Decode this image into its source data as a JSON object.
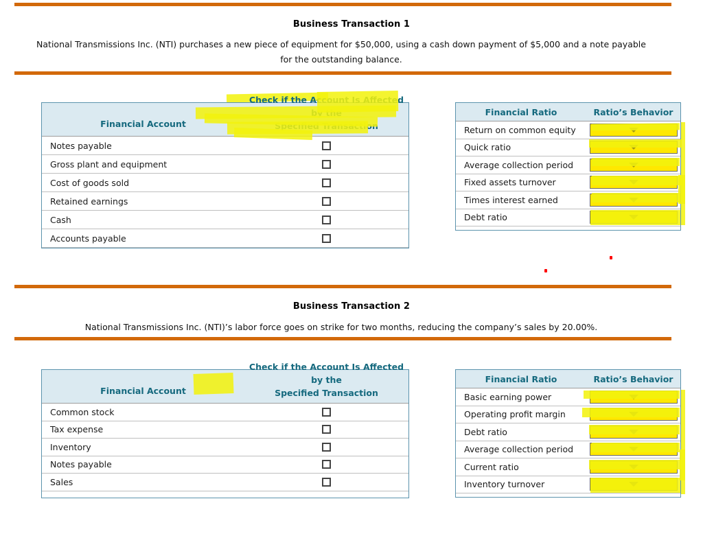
{
  "theme": {
    "rule_color": "#d2690a",
    "header_bg": "#dbeaf1",
    "header_text": "#15697e",
    "card_border": "#5b93ad",
    "highlight_yellow": "#f2f20d",
    "dropdown_yellow": "#ffe800",
    "mark_red": "#fe0000"
  },
  "transactions": [
    {
      "title": "Business Transaction 1",
      "description_line1": "National Transmissions Inc. (NTI) purchases a new piece of equipment for $50,000, using a cash down payment of $5,000 and a note payable",
      "description_line2": "for the outstanding balance.",
      "accounts_table": {
        "col1_header": "Financial Account",
        "col2_header_line1": "Check if the Account Is Affected by the",
        "col2_header_line2": "Specified Transaction",
        "rows": [
          {
            "account": "Notes payable",
            "checked": false
          },
          {
            "account": "Gross plant and equipment",
            "checked": false
          },
          {
            "account": "Cost of goods sold",
            "checked": false
          },
          {
            "account": "Retained earnings",
            "checked": false
          },
          {
            "account": "Cash",
            "checked": false
          },
          {
            "account": "Accounts payable",
            "checked": false
          }
        ]
      },
      "ratios_table": {
        "col1_header": "Financial Ratio",
        "col2_header": "Ratio’s Behavior",
        "rows": [
          {
            "ratio": "Return on common equity",
            "behavior": ""
          },
          {
            "ratio": "Quick ratio",
            "behavior": ""
          },
          {
            "ratio": "Average collection period",
            "behavior": ""
          },
          {
            "ratio": "Fixed assets turnover",
            "behavior": ""
          },
          {
            "ratio": "Times interest earned",
            "behavior": ""
          },
          {
            "ratio": "Debt ratio",
            "behavior": ""
          }
        ]
      }
    },
    {
      "title": "Business Transaction 2",
      "description_line1": "National Transmissions Inc. (NTI)’s labor force goes on strike for two months, reducing the company’s sales by 20.00%.",
      "description_line2": "",
      "accounts_table": {
        "col1_header": "Financial Account",
        "col2_header_line1": "Check if the Account Is Affected by the",
        "col2_header_line2": "Specified Transaction",
        "rows": [
          {
            "account": "Common stock",
            "checked": false
          },
          {
            "account": "Tax expense",
            "checked": false
          },
          {
            "account": "Inventory",
            "checked": false
          },
          {
            "account": "Notes payable",
            "checked": false
          },
          {
            "account": "Sales",
            "checked": false
          }
        ]
      },
      "ratios_table": {
        "col1_header": "Financial Ratio",
        "col2_header": "Ratio’s Behavior",
        "rows": [
          {
            "ratio": "Basic earning power",
            "behavior": ""
          },
          {
            "ratio": "Operating profit margin",
            "behavior": ""
          },
          {
            "ratio": "Debt ratio",
            "behavior": ""
          },
          {
            "ratio": "Average collection period",
            "behavior": ""
          },
          {
            "ratio": "Current ratio",
            "behavior": ""
          },
          {
            "ratio": "Inventory turnover",
            "behavior": ""
          }
        ]
      }
    }
  ],
  "icons": {
    "dropdown_caret": "chevron-down-icon",
    "checkbox": "checkbox-icon"
  }
}
